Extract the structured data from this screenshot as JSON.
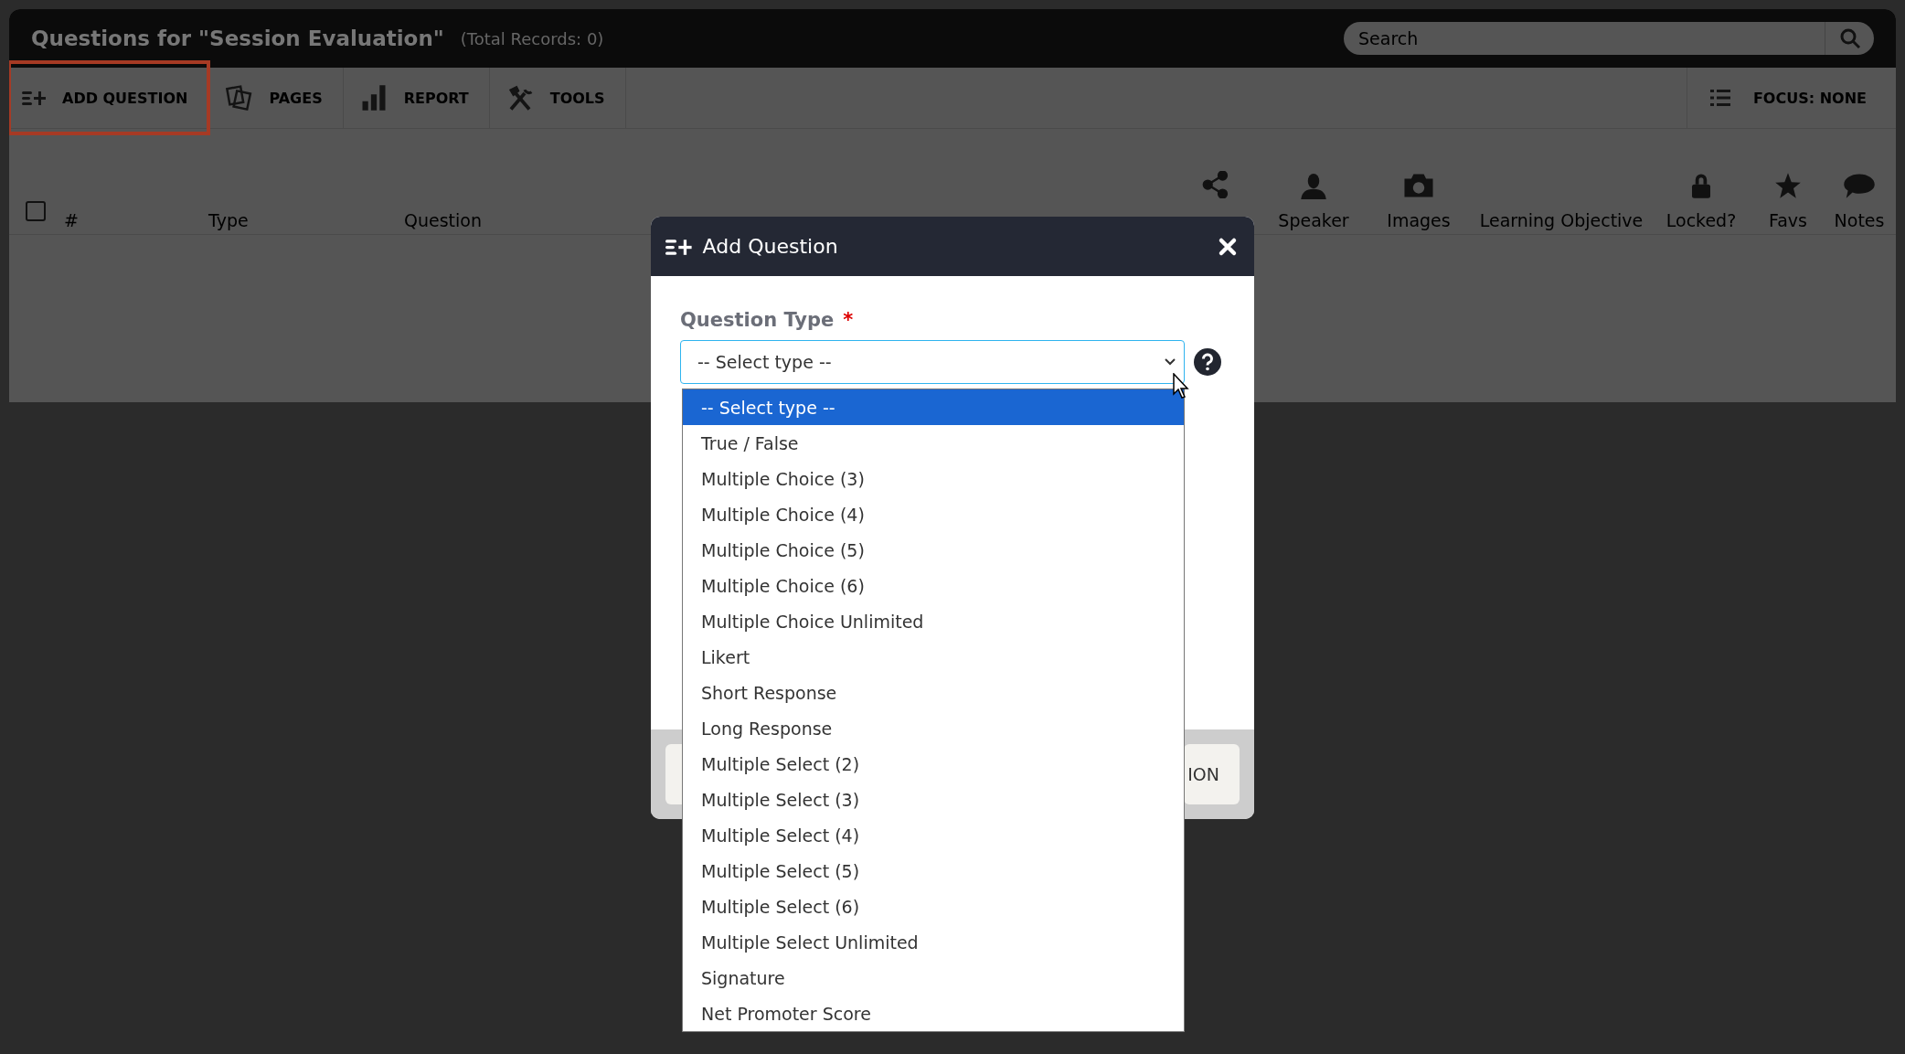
{
  "header": {
    "title": "Questions for \"Session Evaluation\"",
    "record_count": "(Total Records: 0)",
    "search": {
      "placeholder": "Search"
    }
  },
  "toolbar": [
    {
      "label": "ADD QUESTION",
      "highlighted": true
    },
    {
      "label": "PAGES",
      "highlighted": false
    },
    {
      "label": "REPORT",
      "highlighted": false
    },
    {
      "label": "TOOLS",
      "highlighted": false
    }
  ],
  "focus": {
    "label": "FOCUS: NONE"
  },
  "table": {
    "select_all": {
      "checked": false
    },
    "columns": [
      {
        "label": "#"
      },
      {
        "label": "Type"
      },
      {
        "label": "Question"
      },
      {
        "kind": "icon"
      },
      {
        "label": "Speaker",
        "kind": "icon"
      },
      {
        "label": "Images",
        "kind": "icon"
      },
      {
        "label": "Learning Objective",
        "kind": "text"
      },
      {
        "label": "Locked?",
        "kind": "icon"
      },
      {
        "label": "Favs",
        "kind": "icon"
      },
      {
        "label": "Notes",
        "kind": "icon"
      }
    ]
  },
  "modal": {
    "title": "Add Question",
    "field": {
      "label": "Question Type",
      "required_mark": "*",
      "value": "-- Select type --"
    },
    "footer_buttons": [
      {
        "kind": "blank"
      },
      {
        "kind": "text",
        "label": "ION"
      }
    ],
    "options": [
      {
        "label": "-- Select type --",
        "selected": true
      },
      {
        "label": "True / False",
        "selected": false
      },
      {
        "label": "Multiple Choice (3)",
        "selected": false
      },
      {
        "label": "Multiple Choice (4)",
        "selected": false
      },
      {
        "label": "Multiple Choice (5)",
        "selected": false
      },
      {
        "label": "Multiple Choice (6)",
        "selected": false
      },
      {
        "label": "Multiple Choice Unlimited",
        "selected": false
      },
      {
        "label": "Likert",
        "selected": false
      },
      {
        "label": "Short Response",
        "selected": false
      },
      {
        "label": "Long Response",
        "selected": false
      },
      {
        "label": "Multiple Select (2)",
        "selected": false
      },
      {
        "label": "Multiple Select (3)",
        "selected": false
      },
      {
        "label": "Multiple Select (4)",
        "selected": false
      },
      {
        "label": "Multiple Select (5)",
        "selected": false
      },
      {
        "label": "Multiple Select (6)",
        "selected": false
      },
      {
        "label": "Multiple Select Unlimited",
        "selected": false
      },
      {
        "label": "Signature",
        "selected": false
      },
      {
        "label": "Net Promoter Score",
        "selected": false
      }
    ]
  }
}
